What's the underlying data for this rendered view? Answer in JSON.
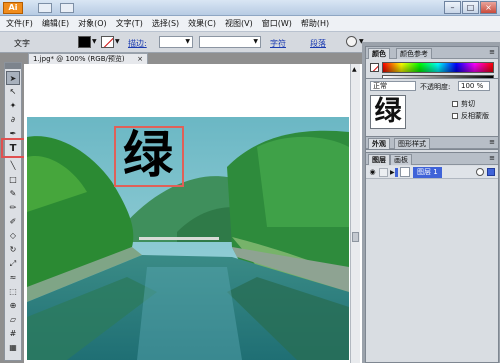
{
  "titlebar": {
    "app_logo": "Ai",
    "controls": [
      "–",
      "□",
      "×"
    ]
  },
  "menubar": {
    "items": [
      "文件(F)",
      "编辑(E)",
      "对象(O)",
      "文字(T)",
      "选择(S)",
      "效果(C)",
      "视图(V)",
      "窗口(W)",
      "帮助(H)"
    ]
  },
  "controlbar": {
    "label": "文字",
    "stroke_link": "描边:",
    "char_link": "字符",
    "para_link": "段落"
  },
  "tools": {
    "icons": [
      "selection-icon",
      "direct-selection-icon",
      "magic-wand-icon",
      "lasso-icon",
      "pen-icon",
      "type-icon",
      "line-icon",
      "rectangle-icon",
      "paintbrush-icon",
      "pencil-icon",
      "blob-brush-icon",
      "eraser-icon",
      "rotate-icon",
      "scale-icon",
      "warp-icon",
      "free-transform-icon",
      "shape-builder-icon",
      "perspective-icon",
      "mesh-icon",
      "gradient-icon",
      "eyedropper-icon"
    ],
    "active": "type-icon"
  },
  "document": {
    "tab_title": "1.jpg* @ 100% (RGB/预览)",
    "big_char": "绿"
  },
  "panels": {
    "color": {
      "tabs": [
        "颜色",
        "颜色参考"
      ]
    },
    "transparency": {
      "blend_mode": "正常",
      "opacity_label": "不透明度:",
      "opacity_value": "100 %",
      "thumb_char": "绿",
      "options": [
        "剪切",
        "反相蒙版"
      ]
    },
    "appearance": {
      "tabs": [
        "外观",
        "图形样式"
      ]
    },
    "layers": {
      "tabs": [
        "图层",
        "画板"
      ],
      "layer_name": "图层 1"
    }
  },
  "colors": {
    "selection_highlight": "#e05050",
    "layer_accent": "#3f63d8"
  }
}
